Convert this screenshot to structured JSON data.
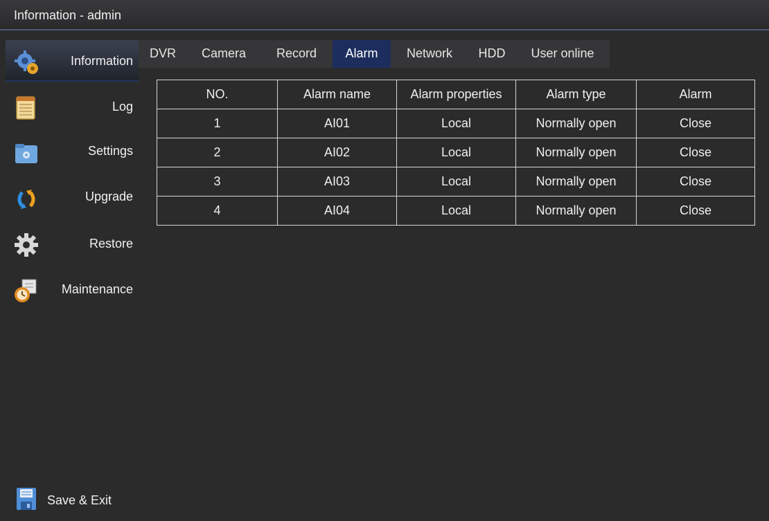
{
  "window": {
    "title": "Information - admin"
  },
  "sidebar": {
    "items": [
      {
        "label": "Information",
        "icon": "gear-info-icon",
        "active": true
      },
      {
        "label": "Log",
        "icon": "notepad-icon"
      },
      {
        "label": "Settings",
        "icon": "settings-folder-icon"
      },
      {
        "label": "Upgrade",
        "icon": "refresh-arrows-icon"
      },
      {
        "label": "Restore",
        "icon": "gear-icon"
      },
      {
        "label": "Maintenance",
        "icon": "clock-calendar-icon"
      }
    ],
    "save_exit": {
      "label": "Save & Exit",
      "icon": "floppy-disk-icon"
    }
  },
  "tabs": [
    "DVR",
    "Camera",
    "Record",
    "Alarm",
    "Network",
    "HDD",
    "User online"
  ],
  "active_tab": "Alarm",
  "table": {
    "headers": [
      "NO.",
      "Alarm name",
      "Alarm properties",
      "Alarm type",
      "Alarm"
    ],
    "rows": [
      [
        "1",
        "AI01",
        "Local",
        "Normally open",
        "Close"
      ],
      [
        "2",
        "AI02",
        "Local",
        "Normally open",
        "Close"
      ],
      [
        "3",
        "AI03",
        "Local",
        "Normally open",
        "Close"
      ],
      [
        "4",
        "AI04",
        "Local",
        "Normally open",
        "Close"
      ]
    ]
  },
  "colors": {
    "background": "#2b2b2b",
    "active_tab": "#1d2e5e",
    "grid_line": "#d6d6d6"
  }
}
